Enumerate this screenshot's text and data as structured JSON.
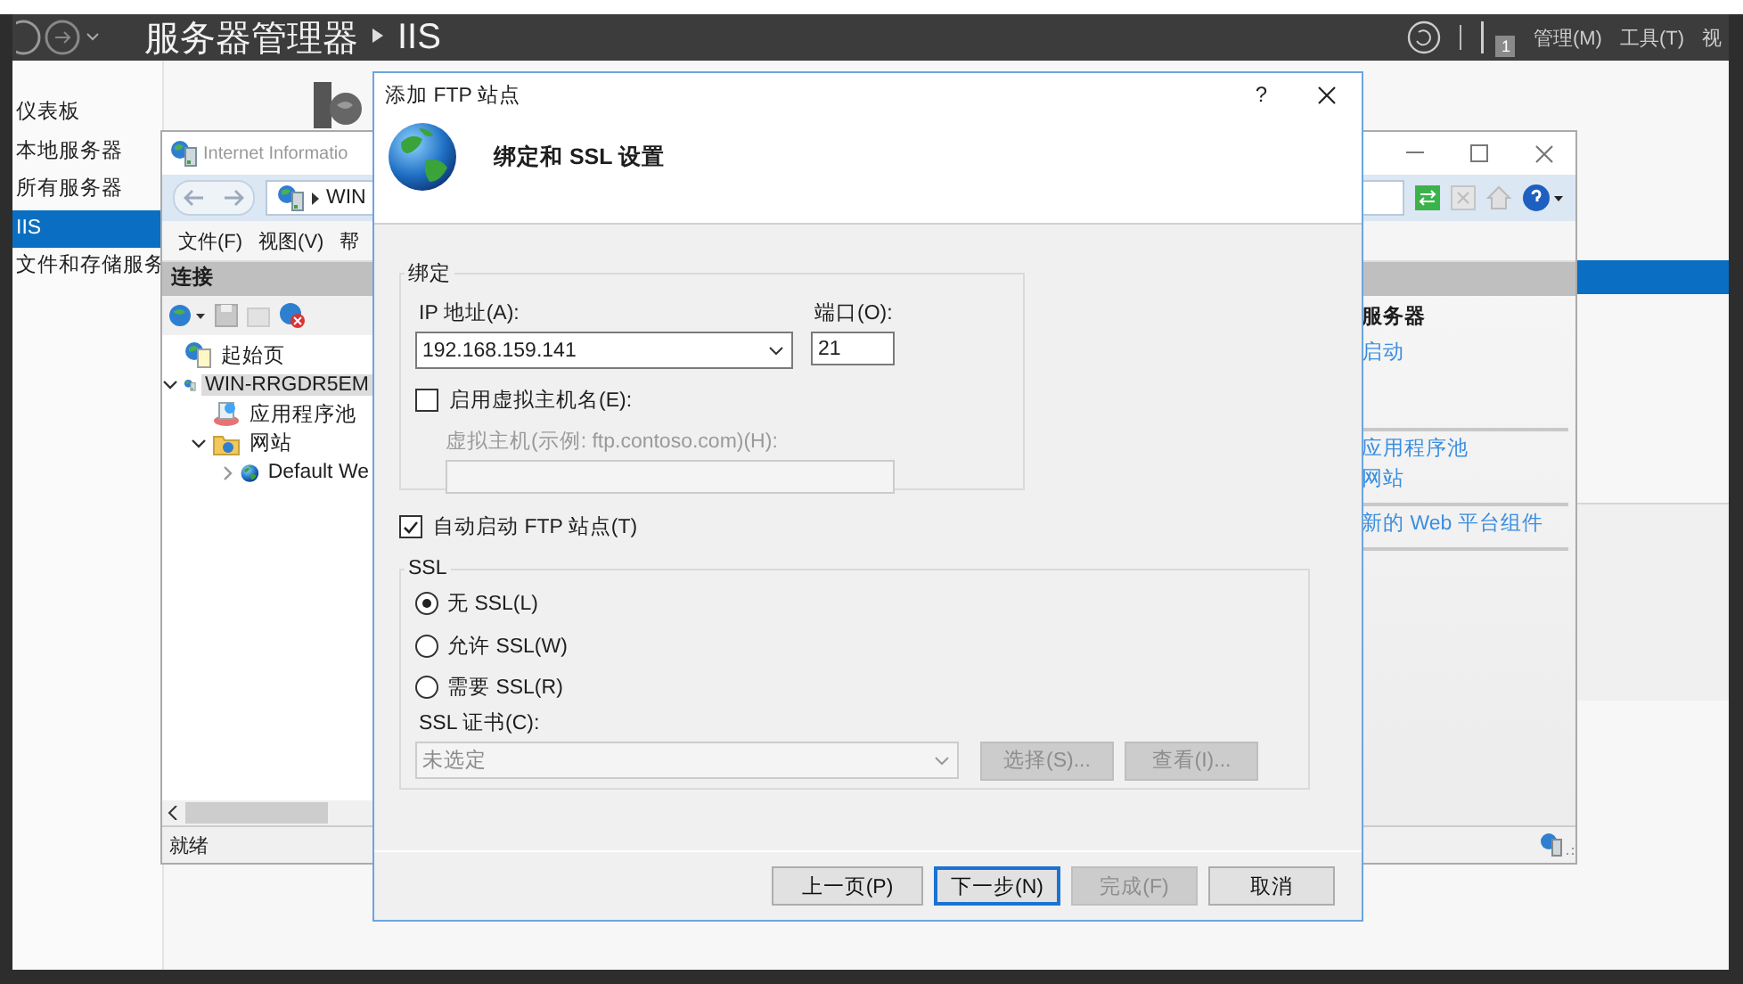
{
  "server_manager": {
    "title": "服务器管理器",
    "breadcrumb": "IIS",
    "menu": [
      "管理(M)",
      "工具(T)",
      "视"
    ],
    "notification_count": "1",
    "nav": [
      {
        "label": "仪表板",
        "selected": false
      },
      {
        "label": "本地服务器",
        "selected": false
      },
      {
        "label": "所有服务器",
        "selected": false
      },
      {
        "label": "IIS",
        "selected": true
      },
      {
        "label": "文件和存储服务",
        "selected": false
      }
    ]
  },
  "iis_window": {
    "title": "Internet Informatio",
    "address": "WIN",
    "menu": [
      "文件(F)",
      "视图(V)",
      "帮"
    ],
    "connections": {
      "title": "连接",
      "tree": [
        {
          "label": "起始页",
          "kind": "page",
          "selected": false
        },
        {
          "label": "WIN-RRGDR5EM",
          "kind": "server",
          "selected": true,
          "expanded": true,
          "children": [
            {
              "label": "应用程序池",
              "kind": "pool",
              "selected": false
            },
            {
              "label": "网站",
              "kind": "folder",
              "selected": false,
              "expanded": true,
              "children": [
                {
                  "label": "Default We",
                  "kind": "globe",
                  "selected": false,
                  "expanded": false
                }
              ]
            }
          ]
        }
      ]
    },
    "actions": {
      "heading": "服务器",
      "groups": [
        [
          "启动"
        ],
        [
          "应用程序池",
          "网站"
        ],
        [
          "新的 Web 平台组件"
        ]
      ]
    },
    "status": "就绪"
  },
  "dialog": {
    "title": "添加 FTP 站点",
    "help": "?",
    "heading": "绑定和 SSL 设置",
    "binding": {
      "legend": "绑定",
      "ip_label": "IP 地址(A):",
      "ip_value": "192.168.159.141",
      "port_label": "端口(O):",
      "port_value": "21",
      "virtual_host": {
        "label": "启用虚拟主机名(E):",
        "checked": false
      },
      "host_label": "虚拟主机(示例: ftp.contoso.com)(H):",
      "host_disabled": true
    },
    "auto_start": {
      "label": "自动启动 FTP 站点(T)",
      "checked": true
    },
    "ssl": {
      "legend": "SSL",
      "options": [
        {
          "label": "无 SSL(L)",
          "selected": true
        },
        {
          "label": "允许 SSL(W)",
          "selected": false
        },
        {
          "label": "需要 SSL(R)",
          "selected": false
        }
      ],
      "cert_label": "SSL 证书(C):",
      "cert_value": "未选定",
      "disabled": true,
      "buttons": [
        {
          "label": "选择(S)...",
          "disabled": true
        },
        {
          "label": "查看(I)...",
          "disabled": true
        }
      ]
    },
    "buttons": [
      {
        "label": "上一页(P)",
        "disabled": false,
        "default": false
      },
      {
        "label": "下一步(N)",
        "disabled": false,
        "default": true
      },
      {
        "label": "完成(F)",
        "disabled": true,
        "default": false
      },
      {
        "label": "取消",
        "disabled": false,
        "default": false
      }
    ]
  }
}
